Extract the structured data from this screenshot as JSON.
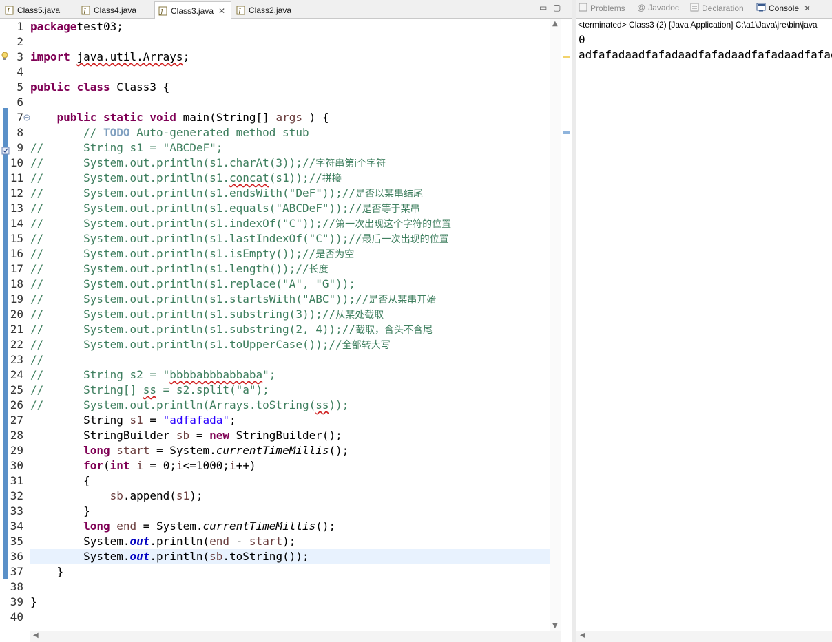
{
  "editor": {
    "tabs": [
      {
        "label": "Class5.java"
      },
      {
        "label": "Class4.java"
      },
      {
        "label": "Class3.java",
        "active": true
      },
      {
        "label": "Class2.java"
      }
    ],
    "window_controls": {
      "minimize": "▭",
      "maximize": "▢"
    },
    "close_glyph": "✕",
    "current_line": 36
  },
  "console": {
    "tabs": [
      {
        "label": "Problems",
        "icon": "problems-icon"
      },
      {
        "label": "Javadoc",
        "icon": "javadoc-at-icon"
      },
      {
        "label": "Declaration",
        "icon": "declaration-icon"
      },
      {
        "label": "Console",
        "icon": "console-icon",
        "active": true
      }
    ],
    "status": "<terminated> Class3 (2) [Java Application] C:\\a1\\Java\\jre\\bin\\java",
    "output": [
      "0",
      "adfafadaadfafadaadfafadaadfafadaadfafadaadfafadaa"
    ]
  },
  "colors": {
    "keyword": "#7f0055",
    "comment": "#3f7f5f",
    "string": "#2a00ff",
    "field": "#0000c0",
    "current_line": "#e8f2fe"
  }
}
